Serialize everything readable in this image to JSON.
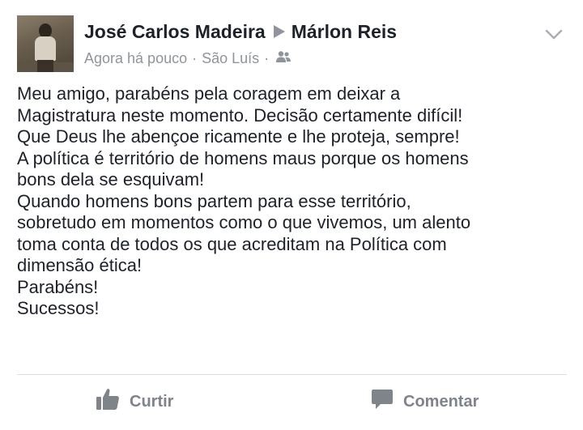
{
  "post": {
    "author": "José Carlos Madeira",
    "recipient": "Márlon Reis",
    "time": "Agora há pouco",
    "separator": "·",
    "location": "São Luís",
    "audience_icon": "friends-icon",
    "menu_icon": "chevron-down-icon",
    "body_lines": [
      "Meu amigo, parabéns pela coragem em deixar a",
      "Magistratura neste momento. Decisão certamente difícil!",
      "Que Deus lhe abençoe ricamente e lhe proteja, sempre!",
      "A política é território de homens maus porque os homens",
      "bons dela se esquivam!",
      "Quando homens bons partem para esse território,",
      "sobretudo em momentos como o que vivemos, um alento",
      "toma conta de todos os que acreditam na Política com",
      "dimensão ética!",
      "Parabéns!",
      "Sucessos!"
    ]
  },
  "actions": {
    "like_label": "Curtir",
    "like_icon": "thumbs-up-icon",
    "comment_label": "Comentar",
    "comment_icon": "comment-icon"
  },
  "colors": {
    "text": "#1d2129",
    "meta": "#90949c",
    "action": "#7f838a",
    "divider": "#dddfe2"
  }
}
